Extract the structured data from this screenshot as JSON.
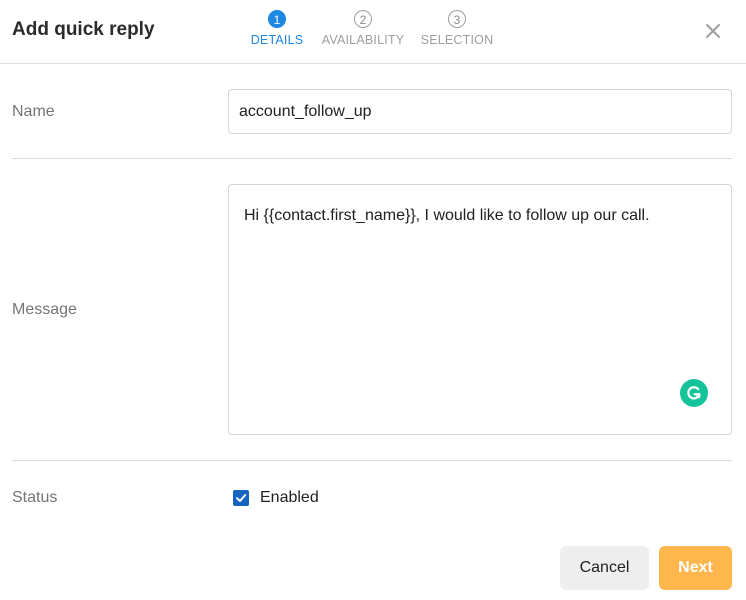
{
  "dialog": {
    "title": "Add quick reply"
  },
  "steps": [
    {
      "number": "1",
      "label": "DETAILS",
      "active": true
    },
    {
      "number": "2",
      "label": "AVAILABILITY",
      "active": false
    },
    {
      "number": "3",
      "label": "SELECTION",
      "active": false
    }
  ],
  "form": {
    "name_label": "Name",
    "name_value": "account_follow_up",
    "message_label": "Message",
    "message_value": "Hi {{contact.first_name}}, I would like to follow up our call.",
    "status_label": "Status",
    "status_option_label": "Enabled",
    "status_checked": true
  },
  "footer": {
    "cancel_label": "Cancel",
    "next_label": "Next"
  },
  "icons": {
    "close": "close-icon",
    "grammarly": "grammarly-icon",
    "check": "checkmark-icon"
  },
  "colors": {
    "accent": "#1e88e5",
    "next_button": "#ffb74d",
    "grammarly": "#15c39a",
    "checkbox": "#1565c0"
  }
}
